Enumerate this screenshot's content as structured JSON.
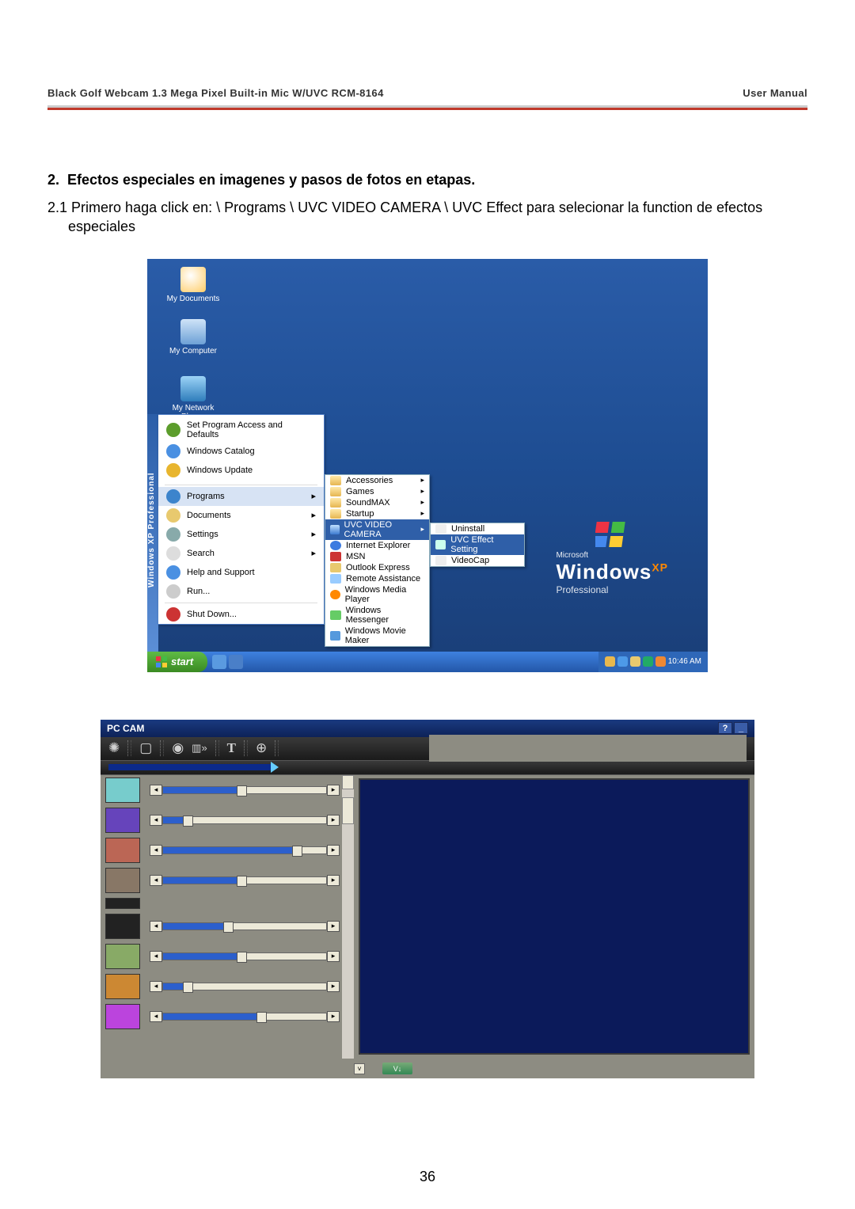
{
  "header": {
    "product_line": "Black Golf Webcam 1.3 Mega Pixel Built-in Mic W/UVC ",
    "model": "RCM-8164",
    "doc_type": "User  Manual"
  },
  "section": {
    "number": "2.",
    "title": "Efectos especiales en imagenes y pasos de fotos en etapas.",
    "step_no": "2.1",
    "step_text": "Primero haga click en: \\ Programs \\ UVC VIDEO CAMERA \\ UVC Effect para selecionar la function de efectos especiales"
  },
  "xp": {
    "desktop_icons": [
      "My Documents",
      "My Computer",
      "My Network Places"
    ],
    "strip": "Windows XP Professional",
    "logo": {
      "ms": "Microsoft",
      "win": "Windows",
      "pro": "Professional"
    },
    "top_items": [
      "Set Program Access and Defaults",
      "Windows Catalog",
      "Windows Update"
    ],
    "mid_items": [
      "Programs",
      "Documents",
      "Settings",
      "Search",
      "Help and Support",
      "Run..."
    ],
    "shutdown": "Shut Down...",
    "sub1": [
      "Accessories",
      "Games",
      "SoundMAX",
      "Startup",
      "UVC VIDEO CAMERA",
      "Internet Explorer",
      "MSN",
      "Outlook Express",
      "Remote Assistance",
      "Windows Media Player",
      "Windows Messenger",
      "Windows Movie Maker"
    ],
    "sub1_hl_index": 4,
    "sub2": [
      "Uninstall",
      "UVC Effect Setting",
      "VideoCap"
    ],
    "sub2_hl_index": 1,
    "start": "start",
    "clock": "10:46 AM"
  },
  "pccam": {
    "title": "PC CAM",
    "help": "?",
    "min": "_",
    "bottom_btn": "V↓",
    "fx_fill_pct": [
      48,
      15,
      82,
      48,
      40,
      48,
      15,
      60
    ]
  },
  "page_no": "36"
}
